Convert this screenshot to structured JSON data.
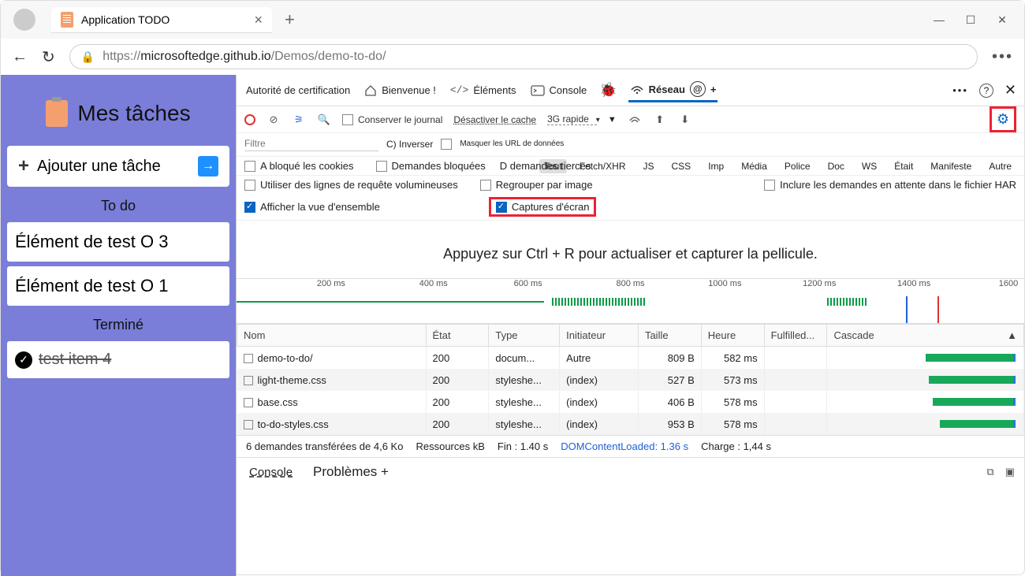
{
  "browser": {
    "tab_title": "Application TODO",
    "url_prefix": "https://",
    "url_host": "microsoftedge.github.io",
    "url_path": "/Demos/demo-to-do/"
  },
  "app": {
    "title": "Mes tâches",
    "add_placeholder": "Ajouter une tâche",
    "section_todo": "To do",
    "section_done": "Terminé",
    "items_todo": [
      "Élément de test O 3",
      "Élément de test O 1"
    ],
    "items_done": [
      "test item 4"
    ]
  },
  "devtools": {
    "tabs": {
      "cert": "Autorité de certification",
      "welcome": "Bienvenue !",
      "elements": "Éléments",
      "console": "Console",
      "network": "Réseau"
    },
    "toolbar": {
      "preserve": "Conserver le journal",
      "disable_cache": "Désactiver le cache",
      "throttle": "3G rapide"
    },
    "filter": {
      "label": "Filtre",
      "invert": "C) Inverser",
      "hide_data": "Masquer les URL de données",
      "types": [
        "Tout",
        "Fetch/XHR",
        "JS",
        "CSS",
        "Imp",
        "Média",
        "Police",
        "Doc",
        "WS",
        "Était",
        "Manifeste",
        "Autre"
      ]
    },
    "row1": {
      "blocked_cookies": "A bloqué les cookies",
      "blocked_req": "Demandes bloquées",
      "third_party": "D demandes tierces"
    },
    "row2": {
      "large_rows": "Utiliser des lignes de requête volumineuses",
      "group_frame": "Regrouper par image",
      "har_pending": "Inclure les demandes en attente dans le fichier HAR"
    },
    "row3": {
      "overview": "Afficher la vue d'ensemble",
      "screenshots": "Captures d'écran"
    },
    "empty_msg": "Appuyez sur Ctrl + R pour actualiser et capturer la pellicule.",
    "ticks": [
      "200 ms",
      "400 ms",
      "600 ms",
      "800 ms",
      "1000 ms",
      "1200 ms",
      "1400 ms",
      "1600"
    ],
    "columns": [
      "Nom",
      "État",
      "Type",
      "Initiateur",
      "Taille",
      "Heure",
      "Fulfilled...",
      "Cascade"
    ],
    "rows": [
      {
        "name": "demo-to-do/",
        "status": "200",
        "type": "docum...",
        "initiator": "Autre",
        "size": "809 B",
        "time": "582 ms",
        "wf_start": 50,
        "wf_len": 48
      },
      {
        "name": "light-theme.css",
        "status": "200",
        "type": "styleshe...",
        "initiator": "(index)",
        "size": "527 B",
        "time": "573 ms",
        "wf_start": 52,
        "wf_len": 46
      },
      {
        "name": "base.css",
        "status": "200",
        "type": "styleshe...",
        "initiator": "(index)",
        "size": "406 B",
        "time": "578 ms",
        "wf_start": 54,
        "wf_len": 44
      },
      {
        "name": "to-do-styles.css",
        "status": "200",
        "type": "styleshe...",
        "initiator": "(index)",
        "size": "953 B",
        "time": "578 ms",
        "wf_start": 58,
        "wf_len": 40
      }
    ],
    "status": {
      "requests": "6 demandes transférées de 4,6 Ko",
      "resources": "Ressources kB",
      "finish": "Fin : 1.40 s",
      "dcl": "DOMContentLoaded: 1.36 s",
      "load": "Charge : 1,44 s"
    },
    "drawer": {
      "console": "Console",
      "problems": "Problèmes +"
    }
  }
}
